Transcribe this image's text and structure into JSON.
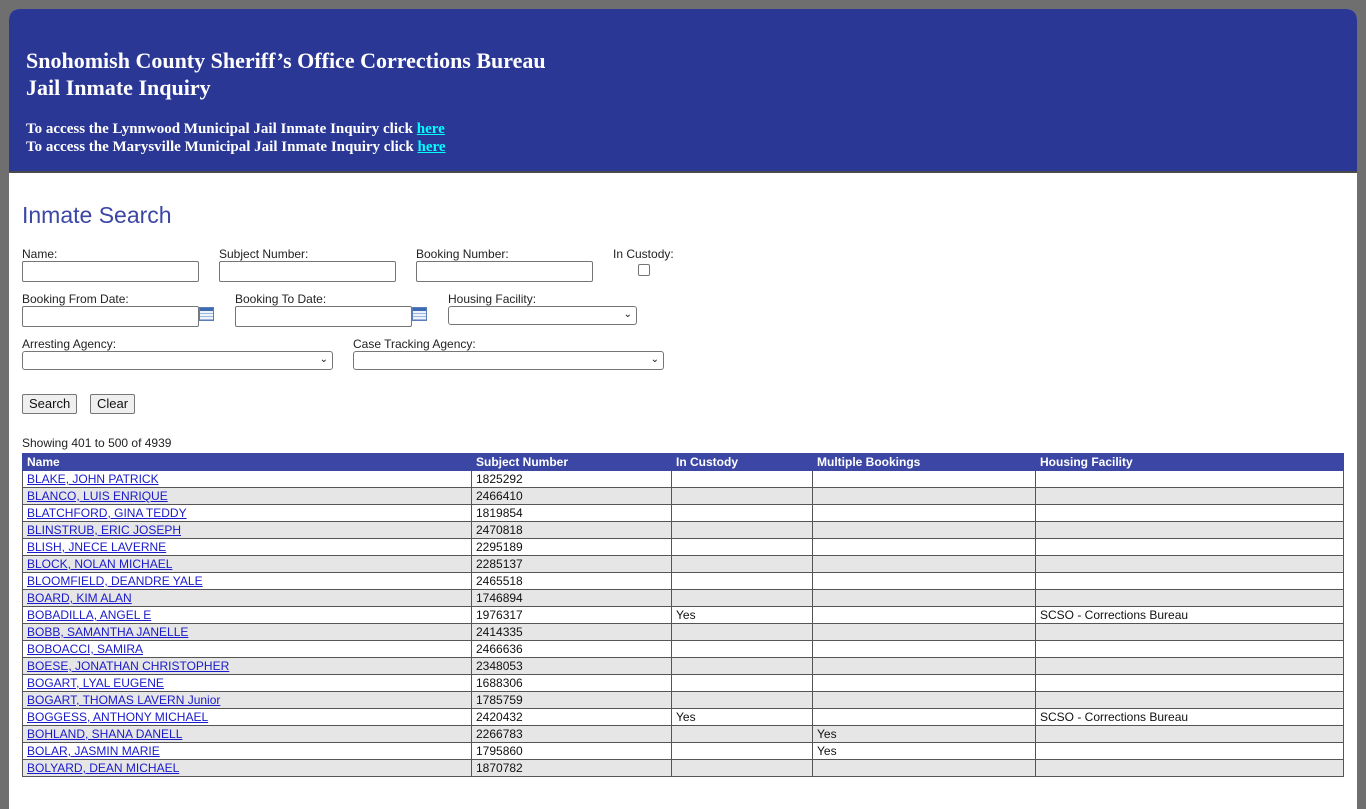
{
  "header": {
    "title_line1": "Snohomish County Sheriff’s Office Corrections Bureau",
    "title_line2": "Jail Inmate Inquiry",
    "lynnwood_text": "To access the Lynnwood Municipal Jail Inmate Inquiry click",
    "marysville_text": "To access the Marysville Municipal Jail Inmate Inquiry click",
    "link_label": "here"
  },
  "search": {
    "heading": "Inmate Search",
    "name_label": "Name:",
    "subject_number_label": "Subject Number:",
    "booking_number_label": "Booking Number:",
    "in_custody_label": "In Custody:",
    "booking_from_label": "Booking From Date:",
    "booking_to_label": "Booking To Date:",
    "housing_facility_label": "Housing Facility:",
    "arresting_agency_label": "Arresting Agency:",
    "case_tracking_label": "Case Tracking Agency:",
    "search_button": "Search",
    "clear_button": "Clear"
  },
  "results": {
    "showing": "Showing 401 to 500 of 4939",
    "columns": [
      "Name",
      "Subject Number",
      "In Custody",
      "Multiple Bookings",
      "Housing Facility"
    ],
    "rows": [
      [
        "BLAKE, JOHN PATRICK",
        "1825292",
        "",
        "",
        ""
      ],
      [
        "BLANCO, LUIS ENRIQUE",
        "2466410",
        "",
        "",
        ""
      ],
      [
        "BLATCHFORD, GINA TEDDY",
        "1819854",
        "",
        "",
        ""
      ],
      [
        "BLINSTRUB, ERIC JOSEPH",
        "2470818",
        "",
        "",
        ""
      ],
      [
        "BLISH, JNECE LAVERNE",
        "2295189",
        "",
        "",
        ""
      ],
      [
        "BLOCK, NOLAN MICHAEL",
        "2285137",
        "",
        "",
        ""
      ],
      [
        "BLOOMFIELD, DEANDRE YALE",
        "2465518",
        "",
        "",
        ""
      ],
      [
        "BOARD, KIM ALAN",
        "1746894",
        "",
        "",
        ""
      ],
      [
        "BOBADILLA, ANGEL E",
        "1976317",
        "Yes",
        "",
        "SCSO - Corrections Bureau"
      ],
      [
        "BOBB, SAMANTHA JANELLE",
        "2414335",
        "",
        "",
        ""
      ],
      [
        "BOBOACCI, SAMIRA",
        "2466636",
        "",
        "",
        ""
      ],
      [
        "BOESE, JONATHAN CHRISTOPHER",
        "2348053",
        "",
        "",
        ""
      ],
      [
        "BOGART, LYAL EUGENE",
        "1688306",
        "",
        "",
        ""
      ],
      [
        "BOGART, THOMAS LAVERN Junior",
        "1785759",
        "",
        "",
        ""
      ],
      [
        "BOGGESS, ANTHONY MICHAEL",
        "2420432",
        "Yes",
        "",
        "SCSO - Corrections Bureau"
      ],
      [
        "BOHLAND, SHANA DANELL",
        "2266783",
        "",
        "Yes",
        ""
      ],
      [
        "BOLAR, JASMIN MARIE",
        "1795860",
        "",
        "Yes",
        ""
      ],
      [
        "BOLYARD, DEAN MICHAEL",
        "1870782",
        "",
        "",
        ""
      ]
    ]
  }
}
